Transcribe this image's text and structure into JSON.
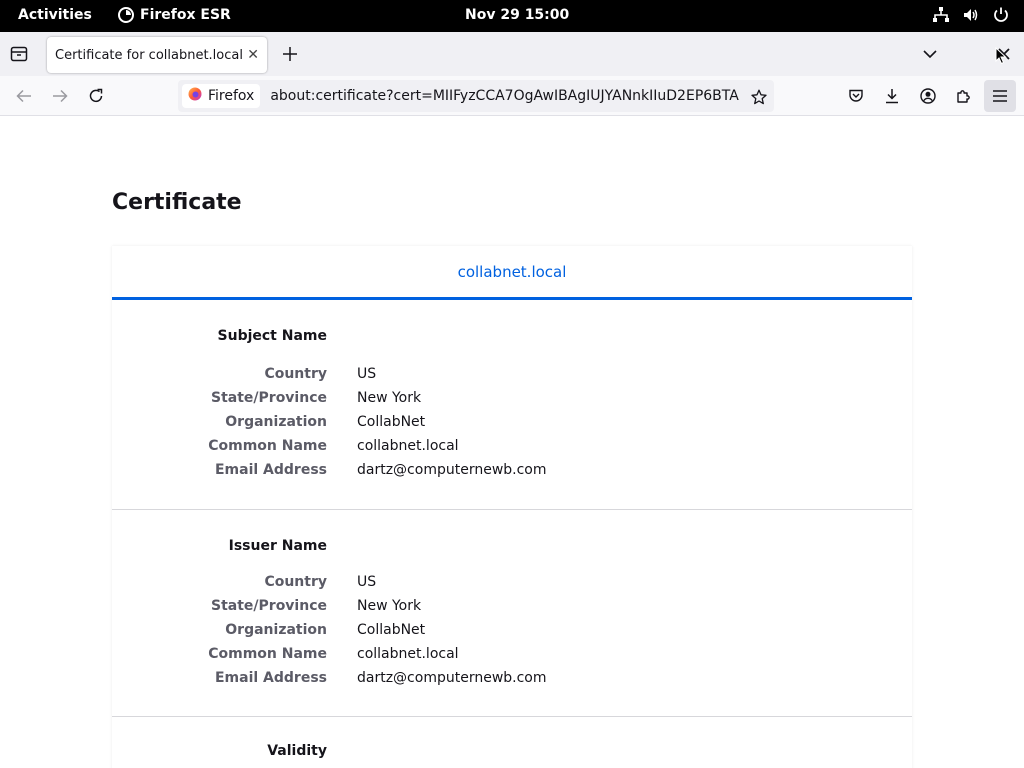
{
  "system_bar": {
    "activities": "Activities",
    "app_name": "Firefox ESR",
    "clock": "Nov 29  15:00"
  },
  "browser": {
    "tab_title": "Certificate for collabnet.local",
    "identity_label": "Firefox",
    "url": "about:certificate?cert=MIIFyzCCA7OgAwIBAgIUJYANnkIIuD2EP6BTA"
  },
  "page": {
    "title": "Certificate",
    "cert_tab": "collabnet.local",
    "subject": {
      "heading": "Subject Name",
      "rows": [
        {
          "label": "Country",
          "value": "US"
        },
        {
          "label": "State/Province",
          "value": "New York"
        },
        {
          "label": "Organization",
          "value": "CollabNet"
        },
        {
          "label": "Common Name",
          "value": "collabnet.local"
        },
        {
          "label": "Email Address",
          "value": "dartz@computernewb.com"
        }
      ]
    },
    "issuer": {
      "heading": "Issuer Name",
      "rows": [
        {
          "label": "Country",
          "value": "US"
        },
        {
          "label": "State/Province",
          "value": "New York"
        },
        {
          "label": "Organization",
          "value": "CollabNet"
        },
        {
          "label": "Common Name",
          "value": "collabnet.local"
        },
        {
          "label": "Email Address",
          "value": "dartz@computernewb.com"
        }
      ]
    },
    "validity": {
      "heading": "Validity"
    }
  },
  "colors": {
    "accent": "#0061e0",
    "label_gray": "#5b5b66"
  }
}
